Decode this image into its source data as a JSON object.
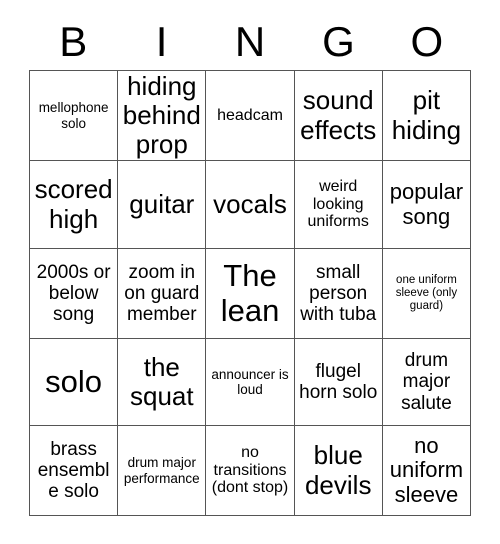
{
  "header": {
    "letters": [
      "B",
      "I",
      "N",
      "G",
      "O"
    ]
  },
  "grid": {
    "rows": 5,
    "columns": 5,
    "border_color": "#555555",
    "background_color": "#ffffff",
    "text_color": "#000000",
    "cells": [
      [
        {
          "text": "mellophone solo",
          "size": "fs-sm"
        },
        {
          "text": "hiding behind prop",
          "size": "fs-xxl"
        },
        {
          "text": "headcam",
          "size": "fs-md"
        },
        {
          "text": "sound effects",
          "size": "fs-xxl"
        },
        {
          "text": "pit hiding",
          "size": "fs-xxl"
        }
      ],
      [
        {
          "text": "scored high",
          "size": "fs-xxl"
        },
        {
          "text": "guitar",
          "size": "fs-xxl"
        },
        {
          "text": "vocals",
          "size": "fs-xxl"
        },
        {
          "text": "weird looking uniforms",
          "size": "fs-md"
        },
        {
          "text": "popular song",
          "size": "fs-xl"
        }
      ],
      [
        {
          "text": "2000s or below song",
          "size": "fs-lg"
        },
        {
          "text": "zoom in on guard member",
          "size": "fs-lg"
        },
        {
          "text": "The lean",
          "size": "fs-huge"
        },
        {
          "text": "small person with tuba",
          "size": "fs-lg"
        },
        {
          "text": "one uniform sleeve (only guard)",
          "size": "fs-xs"
        }
      ],
      [
        {
          "text": "solo",
          "size": "fs-huge"
        },
        {
          "text": "the squat",
          "size": "fs-xxl"
        },
        {
          "text": "announcer is loud",
          "size": "fs-sm"
        },
        {
          "text": "flugel horn solo",
          "size": "fs-lg"
        },
        {
          "text": "drum major salute",
          "size": "fs-lg"
        }
      ],
      [
        {
          "text": "brass ensemble solo",
          "size": "fs-lg"
        },
        {
          "text": "drum major performance",
          "size": "fs-sm"
        },
        {
          "text": "no transitions (dont stop)",
          "size": "fs-md"
        },
        {
          "text": "blue devils",
          "size": "fs-xxl"
        },
        {
          "text": "no uniform sleeve",
          "size": "fs-xl"
        }
      ]
    ]
  }
}
